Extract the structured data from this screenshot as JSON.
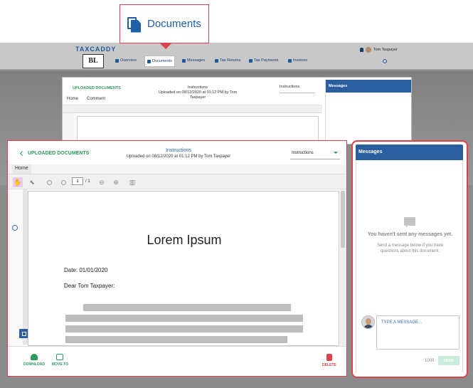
{
  "callout": {
    "label": "Documents"
  },
  "nav": {
    "brand": "TAXCADDY",
    "logo": "BL",
    "items": [
      {
        "label": "Overview"
      },
      {
        "label": "Documents"
      },
      {
        "label": "Messages"
      },
      {
        "label": "Tax Returns"
      },
      {
        "label": "Tax Payments"
      },
      {
        "label": "Invoices"
      }
    ],
    "user": "Tom Taxpayer"
  },
  "background_window": {
    "back_label": "UPLOADED DOCUMENTS",
    "title": "Instructions",
    "subtitle": "Uploaded on 08/12/2020 at 01:12 PM by Tom Taxpayer",
    "select_value": "Instructions",
    "tabs": [
      "Home",
      "Comment"
    ],
    "messages_title": "Messages"
  },
  "viewer": {
    "back_label": "UPLOADED DOCUMENTS",
    "title": "Instructions",
    "subtitle": "Uploaded on 08/12/2020 at 01:12 PM by Tom Taxpayer",
    "select_value": "Instructions",
    "tab_home": "Home",
    "page_input": "1",
    "page_total": "/ 1",
    "document": {
      "heading": "Lorem Ipsum",
      "date_line": "Date: 01/01/2020",
      "salutation": "Dear Tom Taxpayer:"
    },
    "actions": {
      "download": "DOWNLOAD",
      "move": "MOVE TO",
      "delete": "DELETE"
    }
  },
  "messages": {
    "title": "Messages",
    "empty_title": "You haven't sent any messages yet.",
    "empty_sub": "Send a message below if you have questions about this document.",
    "input_placeholder": "TYPE A MESSAGE...",
    "char_count": "1000",
    "send_label": "SEND"
  },
  "colors": {
    "highlight_red": "#d9434b",
    "brand_blue": "#2a5e9e",
    "action_green": "#2c9a5a"
  }
}
